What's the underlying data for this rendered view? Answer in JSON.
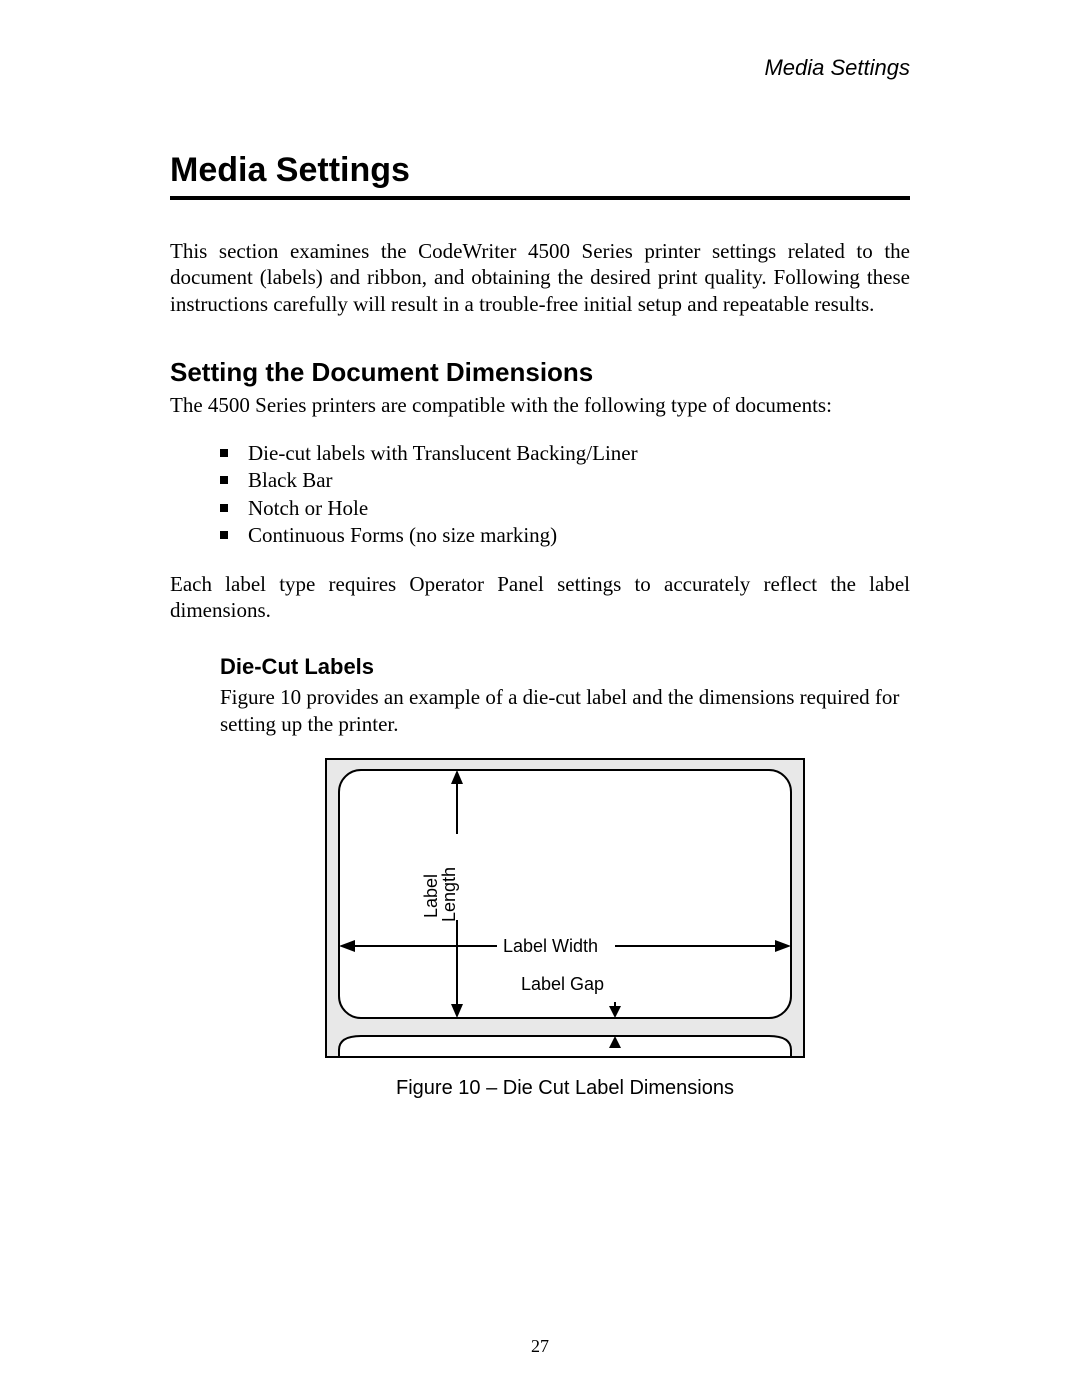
{
  "runningHead": "Media Settings",
  "title": "Media Settings",
  "intro": "This section examines the CodeWriter 4500 Series printer settings related to the document (labels) and ribbon, and obtaining the desired print quality. Following these instructions carefully will result in a trouble-free initial setup and repeatable results.",
  "section1": {
    "heading": "Setting the Document Dimensions",
    "lead": "The 4500 Series printers are compatible with the following type of documents:",
    "bullets": [
      "Die-cut labels with Translucent Backing/Liner",
      "Black Bar",
      "Notch or Hole",
      "Continuous Forms (no size marking)"
    ],
    "trail": "Each label type requires Operator Panel settings to accurately reflect the label dimensions."
  },
  "sub1": {
    "heading": "Die-Cut Labels",
    "text": "Figure 10 provides an example of a die-cut label and the dimensions required for setting up the printer."
  },
  "figure": {
    "labelLength": "Label\nLength",
    "labelWidth": "Label Width",
    "labelGap": "Label Gap",
    "caption": "Figure 10 – Die Cut Label Dimensions"
  },
  "pageNumber": "27"
}
